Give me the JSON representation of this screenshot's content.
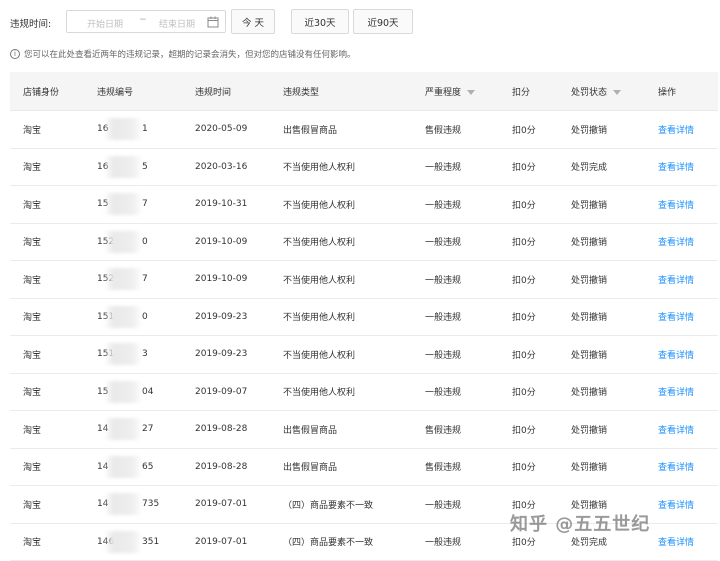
{
  "filter": {
    "label": "违规时间:",
    "start_placeholder": "开始日期",
    "separator": "~",
    "end_placeholder": "结束日期",
    "quick_buttons": [
      "今 天",
      "近30天",
      "近90天"
    ]
  },
  "notice": {
    "icon": "i",
    "text": "您可以在此处查看近两年的违规记录，超期的记录会消失，但对您的店铺没有任何影响。"
  },
  "table": {
    "headers": [
      "店铺身份",
      "违规编号",
      "违规时间",
      "违规类型",
      "严重程度",
      "扣分",
      "处罚状态",
      "操作"
    ],
    "rows": [
      {
        "shop": "淘宝",
        "id_prefix": "16",
        "id_suffix": "1",
        "date": "2020-05-09",
        "type": "出售假冒商品",
        "severity": "售假违规",
        "points": "扣0分",
        "status": "处罚撤销",
        "action": "查看详情"
      },
      {
        "shop": "淘宝",
        "id_prefix": "16",
        "id_suffix": "5",
        "date": "2020-03-16",
        "type": "不当使用他人权利",
        "severity": "一般违规",
        "points": "扣0分",
        "status": "处罚完成",
        "action": "查看详情"
      },
      {
        "shop": "淘宝",
        "id_prefix": "15",
        "id_suffix": "7",
        "date": "2019-10-31",
        "type": "不当使用他人权利",
        "severity": "一般违规",
        "points": "扣0分",
        "status": "处罚撤销",
        "action": "查看详情"
      },
      {
        "shop": "淘宝",
        "id_prefix": "152",
        "id_suffix": "0",
        "date": "2019-10-09",
        "type": "不当使用他人权利",
        "severity": "一般违规",
        "points": "扣0分",
        "status": "处罚撤销",
        "action": "查看详情"
      },
      {
        "shop": "淘宝",
        "id_prefix": "152",
        "id_suffix": "7",
        "date": "2019-10-09",
        "type": "不当使用他人权利",
        "severity": "一般违规",
        "points": "扣0分",
        "status": "处罚撤销",
        "action": "查看详情"
      },
      {
        "shop": "淘宝",
        "id_prefix": "151",
        "id_suffix": "0",
        "date": "2019-09-23",
        "type": "不当使用他人权利",
        "severity": "一般违规",
        "points": "扣0分",
        "status": "处罚撤销",
        "action": "查看详情"
      },
      {
        "shop": "淘宝",
        "id_prefix": "151",
        "id_suffix": "3",
        "date": "2019-09-23",
        "type": "不当使用他人权利",
        "severity": "一般违规",
        "points": "扣0分",
        "status": "处罚撤销",
        "action": "查看详情"
      },
      {
        "shop": "淘宝",
        "id_prefix": "15",
        "id_suffix": "04",
        "date": "2019-09-07",
        "type": "不当使用他人权利",
        "severity": "一般违规",
        "points": "扣0分",
        "status": "处罚撤销",
        "action": "查看详情"
      },
      {
        "shop": "淘宝",
        "id_prefix": "14",
        "id_suffix": "27",
        "date": "2019-08-28",
        "type": "出售假冒商品",
        "severity": "售假违规",
        "points": "扣0分",
        "status": "处罚撤销",
        "action": "查看详情"
      },
      {
        "shop": "淘宝",
        "id_prefix": "14",
        "id_suffix": "65",
        "date": "2019-08-28",
        "type": "出售假冒商品",
        "severity": "售假违规",
        "points": "扣0分",
        "status": "处罚撤销",
        "action": "查看详情"
      },
      {
        "shop": "淘宝",
        "id_prefix": "14",
        "id_suffix": "735",
        "date": "2019-07-01",
        "type": "（四）商品要素不一致",
        "severity": "一般违规",
        "points": "扣0分",
        "status": "处罚撤销",
        "action": "查看详情"
      },
      {
        "shop": "淘宝",
        "id_prefix": "146",
        "id_suffix": "351",
        "date": "2019-07-01",
        "type": "（四）商品要素不一致",
        "severity": "一般违规",
        "points": "扣0分",
        "status": "处罚完成",
        "action": "查看详情"
      }
    ]
  },
  "watermark": "知乎 @五五世纪",
  "colors": {
    "link": "#1890ff",
    "header_bg": "#f5f5f5",
    "border": "#e8e8e8"
  }
}
